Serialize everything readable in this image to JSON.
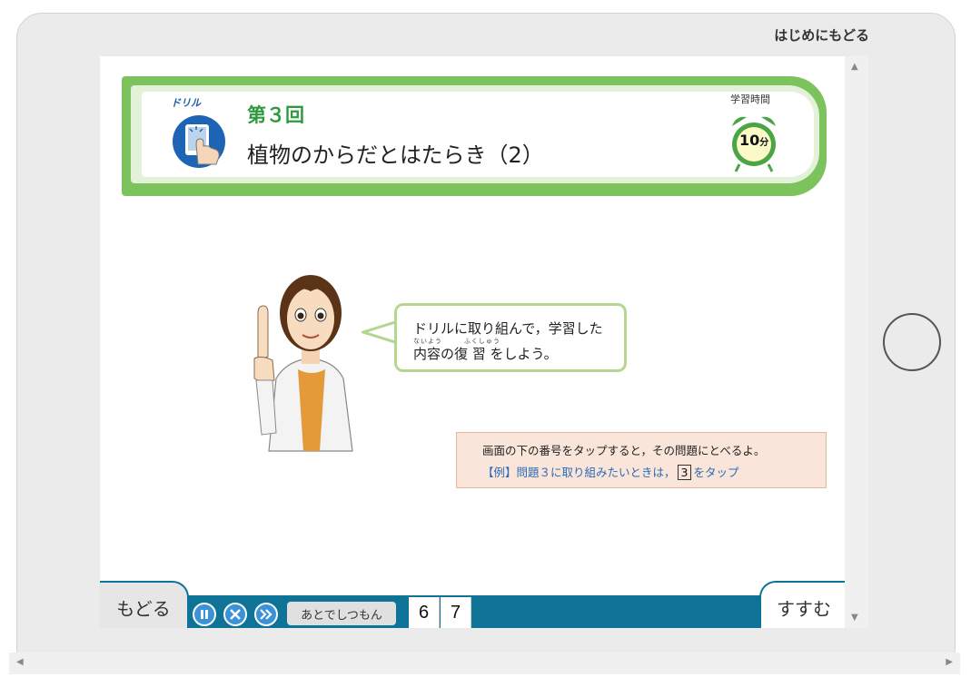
{
  "top_link": "はじめにもどる",
  "header": {
    "drill_label": "ドリル",
    "round": "第３回",
    "title": "植物のからだとはたらき（2）",
    "time_label": "学習時間",
    "time_value": "10",
    "time_unit": "分"
  },
  "bubble": {
    "line1": "ドリルに取り組んで，学習した",
    "ruby": "ないよう　　　ふくしゅう",
    "line2": "内容の復 習 をしよう。"
  },
  "info": {
    "line1": "画面の下の番号をタップすると，その問題にとべるよ。",
    "line2_prefix": "【例】問題３に取り組みたいときは，",
    "line2_num": "3",
    "line2_suffix": "をタップ"
  },
  "nav": {
    "back": "もどる",
    "next": "すすむ",
    "later": "あとでしつもん",
    "questions": [
      "6",
      "7"
    ]
  },
  "colors": {
    "accent_green": "#7cc25d",
    "bar_blue": "#0e7396",
    "control_blue": "#3a93d8",
    "round_green": "#2e9a3e"
  },
  "icons": [
    "pause-icon",
    "close-icon",
    "skip-icon",
    "tap-hand-icon",
    "alarm-clock-icon"
  ]
}
